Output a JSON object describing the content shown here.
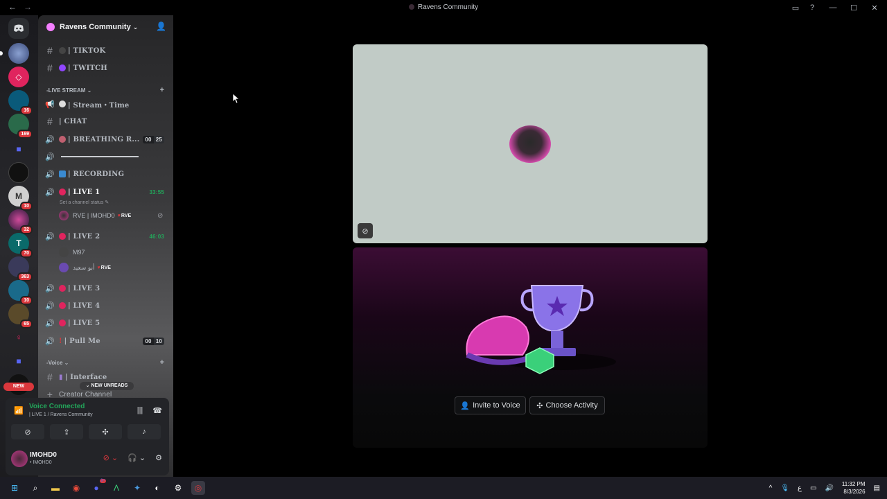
{
  "window": {
    "title": "Ravens Community"
  },
  "guild": {
    "name": "Ravens Community"
  },
  "rail_badges": [
    "16",
    "169",
    "10",
    "32",
    "70",
    "363",
    "10",
    "65"
  ],
  "rail_new": "NEW",
  "channels": {
    "tiktok": "| TIKTOK",
    "twitch": "| TWITCH",
    "cat_live": "-LIVE STREAM",
    "stream_time": "| Stream・Time",
    "chat": "| CHAT",
    "breathing": "| BREATHING R...",
    "breathing_count": [
      "00",
      "25"
    ],
    "recording": "| RECORDING",
    "live1": "| LIVE 1",
    "live1_time": "33:55",
    "live1_status": "Set a channel status",
    "live1_member": "RVE | IMOHD0",
    "live1_member_tag": "RVE",
    "live2": "| LIVE 2",
    "live2_time": "46:03",
    "live2_member1": "M97",
    "live2_member2": "أبو سعيد",
    "live2_member2_tag": "RVE",
    "live3": "| LIVE 3",
    "live4": "| LIVE 4",
    "live5": "| LIVE 5",
    "pullme": "| Pull Me",
    "pullme_count": [
      "00",
      "10"
    ],
    "cat_voice": "-Voice",
    "interface": "| Interface",
    "creator": "Creator Channel",
    "new_unreads": "NEW UNREADS"
  },
  "voice_panel": {
    "status": "Voice Connected",
    "location": "| LIVE 1 / Ravens Community"
  },
  "user_panel": {
    "name": "IMOHD0",
    "sub": "• IMOHD0"
  },
  "stage": {
    "invite_label": "Invite to Voice",
    "activity_label": "Choose Activity"
  },
  "taskbar": {
    "time": "11:32 PM",
    "date": "8/3/2026",
    "lang": "ع",
    "discord_badge": "9+"
  }
}
